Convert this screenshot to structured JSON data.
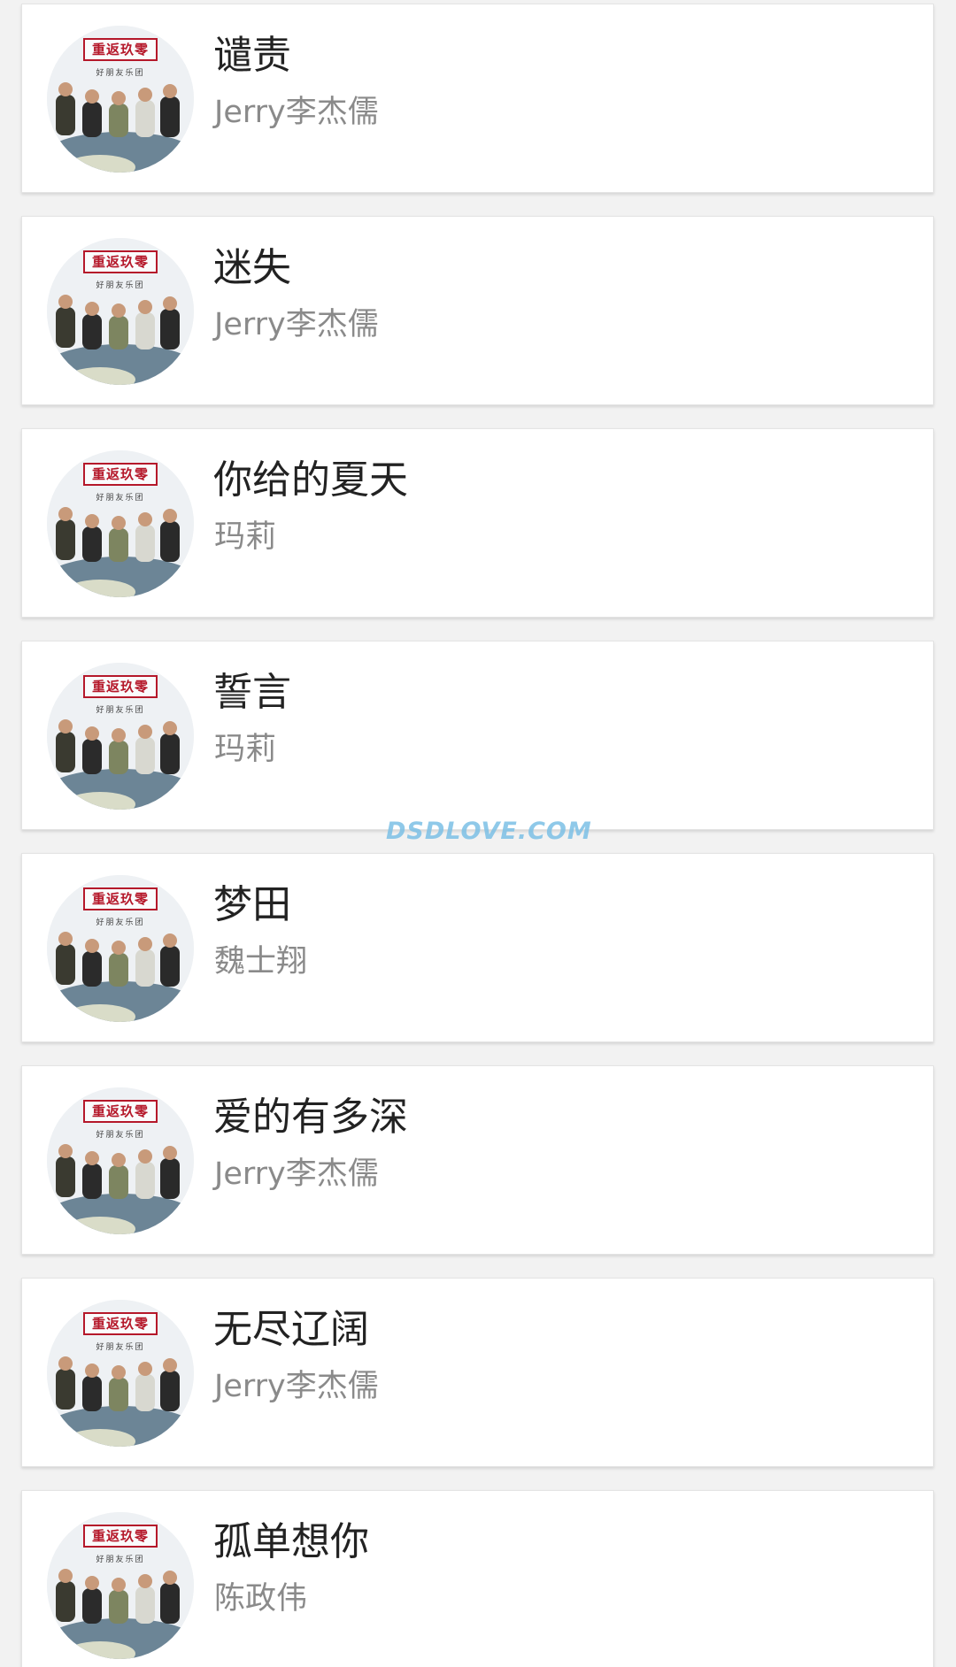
{
  "songs": [
    {
      "title": "谴责",
      "artist": "Jerry李杰儒"
    },
    {
      "title": "迷失",
      "artist": "Jerry李杰儒"
    },
    {
      "title": "你给的夏天",
      "artist": "玛莉"
    },
    {
      "title": "誓言",
      "artist": "玛莉"
    },
    {
      "title": "梦田",
      "artist": "魏士翔"
    },
    {
      "title": "爱的有多深",
      "artist": "Jerry李杰儒"
    },
    {
      "title": "无尽辽阔",
      "artist": "Jerry李杰儒"
    },
    {
      "title": "孤单想你",
      "artist": "陈政伟"
    }
  ],
  "album_cover": {
    "title": "重返玖零",
    "subtitle": "好朋友乐团",
    "accent_color": "#b5182a"
  },
  "watermark": "DSDLOVE.COM"
}
